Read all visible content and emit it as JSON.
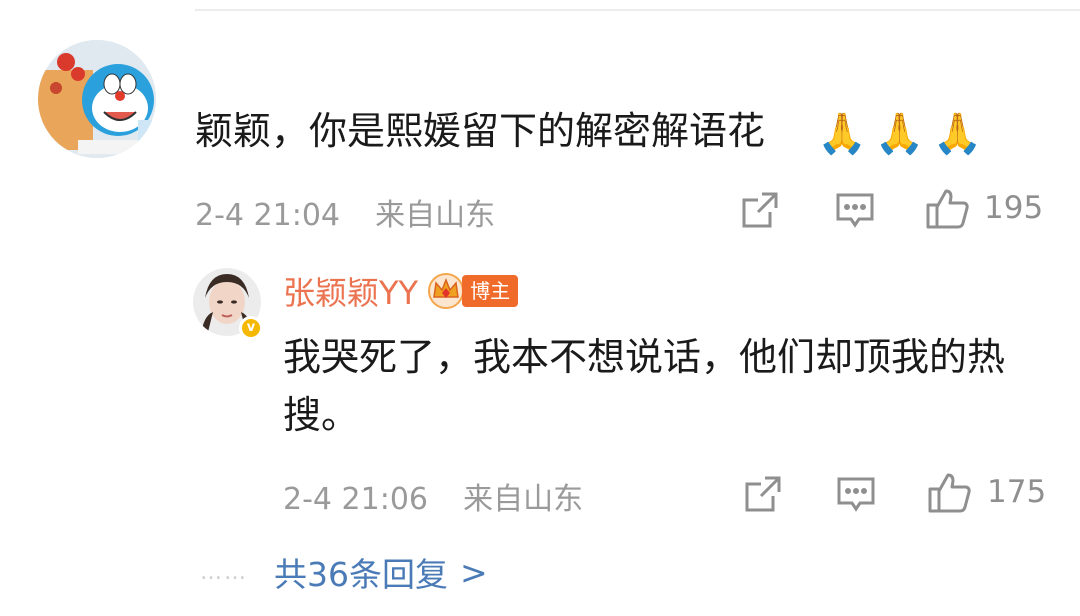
{
  "comment": {
    "text": "颖颖，你是熙媛留下的解密解语花",
    "emojis": [
      "🙏",
      "🙏",
      "🙏"
    ],
    "time": "2-4 21:04",
    "location": "来自山东",
    "likes": "195"
  },
  "reply": {
    "username": "张颖颖YY",
    "author_tag": "博主",
    "text": "我哭死了，我本不想说话，他们却顶我的热搜。",
    "time": "2-4 21:06",
    "location": "来自山东",
    "likes": "175"
  },
  "more": {
    "dots": "……",
    "label": "共36条回复",
    "chevron": ">"
  },
  "colors": {
    "username": "#eb7350",
    "link": "#4a7bb7",
    "meta": "#9a9a9a",
    "tag": "#f06a2a",
    "verified": "#f5b800"
  },
  "icons": [
    "repost-icon",
    "comment-icon",
    "like-icon",
    "crown-icon",
    "verified-icon"
  ]
}
